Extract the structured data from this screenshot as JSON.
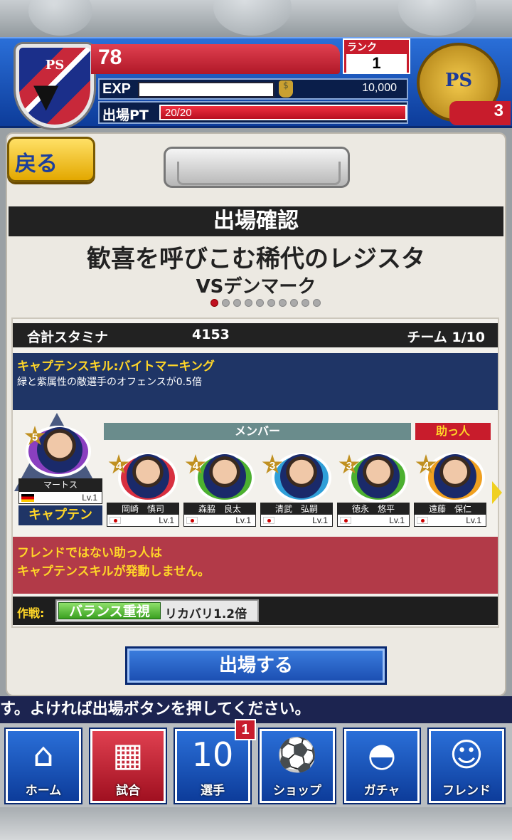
{
  "header": {
    "team_level": "78",
    "rank_label": "ランク",
    "rank_value": "1",
    "exp_label": "EXP",
    "money": "10,000",
    "pt_label": "出場PT",
    "pt_value": "20/20",
    "medal_count": "3",
    "crest_text": "PS"
  },
  "back_label": "戻る",
  "screen_title": "出場確認",
  "quest_title": "歓喜を呼びこむ稀代のレジスタ",
  "opponent": "VSデンマーク",
  "pager": {
    "total": 10,
    "current": 1
  },
  "team": {
    "stamina_label": "合計スタミナ",
    "stamina_value": "4153",
    "team_label": "チーム 1/10"
  },
  "skill": {
    "name": "キャプテンスキル:バイトマーキング",
    "desc": "緑と紫属性の敵選手のオフェンスが0.5倍"
  },
  "members_label": "メンバー",
  "helper_label": "助っ人",
  "captain": {
    "name": "マートス",
    "lv": "Lv.1",
    "cost": "5",
    "role": "キャプテン"
  },
  "members": [
    {
      "name": "岡崎　慎司",
      "lv": "Lv.1",
      "cost": "4",
      "color": "#d83040"
    },
    {
      "name": "森脇　良太",
      "lv": "Lv.1",
      "cost": "4",
      "color": "#4cb030"
    },
    {
      "name": "清武　弘嗣",
      "lv": "Lv.1",
      "cost": "3",
      "color": "#2f9fd8"
    },
    {
      "name": "徳永　悠平",
      "lv": "Lv.1",
      "cost": "3",
      "color": "#4cb030"
    },
    {
      "name": "遠藤　保仁",
      "lv": "Lv.1",
      "cost": "4",
      "color": "#f0a020"
    }
  ],
  "warning": {
    "line1": "フレンドではない助っ人は",
    "line2": "キャプテンスキルが発動しません。"
  },
  "tactic": {
    "label": "作戦:",
    "name": "バランス重視",
    "effect": "リカバリ1.2倍"
  },
  "go_button": "出場する",
  "message": "す。よければ出場ボタンを押してください。",
  "nav": [
    {
      "label": "ホーム",
      "icon": "home-icon"
    },
    {
      "label": "試合",
      "icon": "field-icon"
    },
    {
      "label": "選手",
      "icon": "jersey-icon"
    },
    {
      "label": "ショップ",
      "icon": "ball-icon"
    },
    {
      "label": "ガチャ",
      "icon": "gacha-icon"
    },
    {
      "label": "フレンド",
      "icon": "friends-icon"
    }
  ],
  "nav_badge": "1"
}
